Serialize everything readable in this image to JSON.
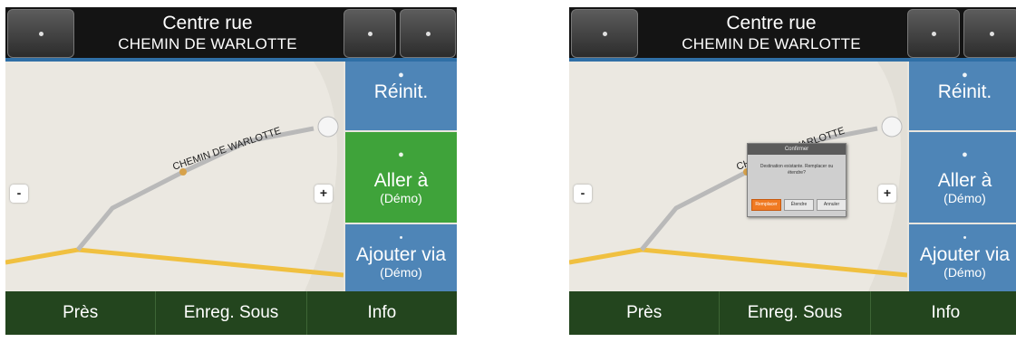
{
  "screens": [
    {
      "header": {
        "mode_title": "Centre rue",
        "street_name": "CHEMIN DE WARLOTTE"
      },
      "map": {
        "street_label": "CHEMIN DE WARLOTTE",
        "zoom_out": "-",
        "zoom_in": "+"
      },
      "side_panel": {
        "reset": {
          "label": "Réinit."
        },
        "goto": {
          "label": "Aller à",
          "sublabel": "(Démo)",
          "selected": true
        },
        "add_via": {
          "label": "Ajouter via",
          "sublabel": "(Démo)"
        }
      },
      "bottom_bar": {
        "near": "Près",
        "save_as": "Enreg. Sous",
        "info": "Info"
      }
    },
    {
      "header": {
        "mode_title": "Centre rue",
        "street_name": "CHEMIN DE WARLOTTE"
      },
      "map": {
        "street_label": "CHEMIN DE WARLOTTE",
        "zoom_out": "-",
        "zoom_in": "+"
      },
      "side_panel": {
        "reset": {
          "label": "Réinit."
        },
        "goto": {
          "label": "Aller à",
          "sublabel": "(Démo)",
          "selected": false
        },
        "add_via": {
          "label": "Ajouter via",
          "sublabel": "(Démo)"
        }
      },
      "dialog": {
        "title": "Confirmer",
        "message": "Destination existante. Remplacer ou étendre?",
        "buttons": [
          "Remplacer",
          "Étendre",
          "Annuler"
        ]
      },
      "bottom_bar": {
        "near": "Près",
        "save_as": "Enreg. Sous",
        "info": "Info"
      }
    }
  ],
  "colors": {
    "header_bg": "#141414",
    "accent": "#2f6fa6",
    "panel_blue": "#4e85b7",
    "selected_green": "#3fa33a",
    "bottom_bar": "#23451e",
    "map_bg": "#ebe8e1",
    "route_yellow": "#f0c040",
    "street_gray": "#b9b9b9",
    "dialog_primary": "#f07a22"
  }
}
